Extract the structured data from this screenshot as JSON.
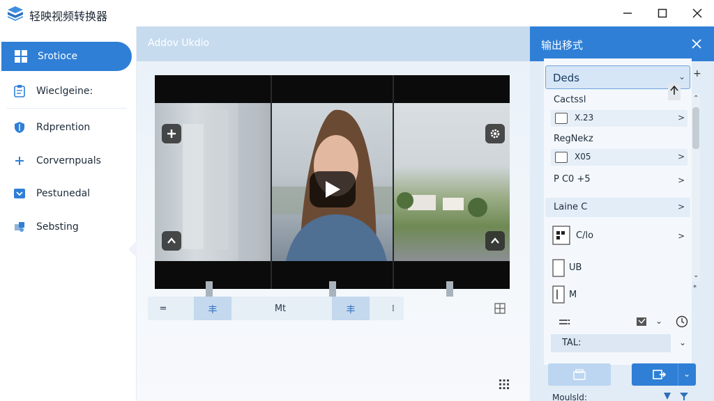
{
  "window": {
    "title": "轻映视频转换器",
    "minimize_icon": "minimize-icon",
    "maximize_icon": "maximize-icon",
    "close_icon": "close-icon"
  },
  "sidebar": {
    "items": [
      {
        "label": "Srotioce",
        "icon": "grid-icon",
        "active": true
      },
      {
        "label": "Wieclgeine:",
        "icon": "clipboard-icon",
        "active": false
      },
      {
        "label": "Rdprention",
        "icon": "shield-icon",
        "active": false
      },
      {
        "label": "Corvernpuals",
        "icon": "plus-box-icon",
        "active": false
      },
      {
        "label": "Pestunedal",
        "icon": "download-box-icon",
        "active": false
      },
      {
        "label": "Sebsting",
        "icon": "puzzle-icon",
        "active": false
      }
    ]
  },
  "editor": {
    "header_title": "Addov Ukdio",
    "timeline": {
      "segments": [
        "=",
        "丰",
        "Mt",
        "丰",
        "⁞"
      ],
      "selected": [
        1,
        3
      ]
    },
    "icons": [
      "add-icon",
      "settings-icon",
      "up-arrow-icon",
      "play-icon",
      "grid-icon"
    ]
  },
  "output_panel": {
    "title": "输出移式",
    "format_select": "Deds",
    "rows": [
      {
        "label": "Cactssl",
        "value": "X.23"
      },
      {
        "label": "RegNekz",
        "value": "X05"
      },
      {
        "label": "P C0 +5"
      },
      {
        "label": "Laine C"
      },
      {
        "label": "C/lo"
      },
      {
        "label": "UB"
      },
      {
        "label": "M"
      }
    ],
    "dropdown_value": "TAL:",
    "footer_text": "Moulsld:"
  },
  "colors": {
    "accent": "#2f7fd6",
    "panel_bg": "#e2ecf6",
    "header_bg": "#c7dbef"
  }
}
